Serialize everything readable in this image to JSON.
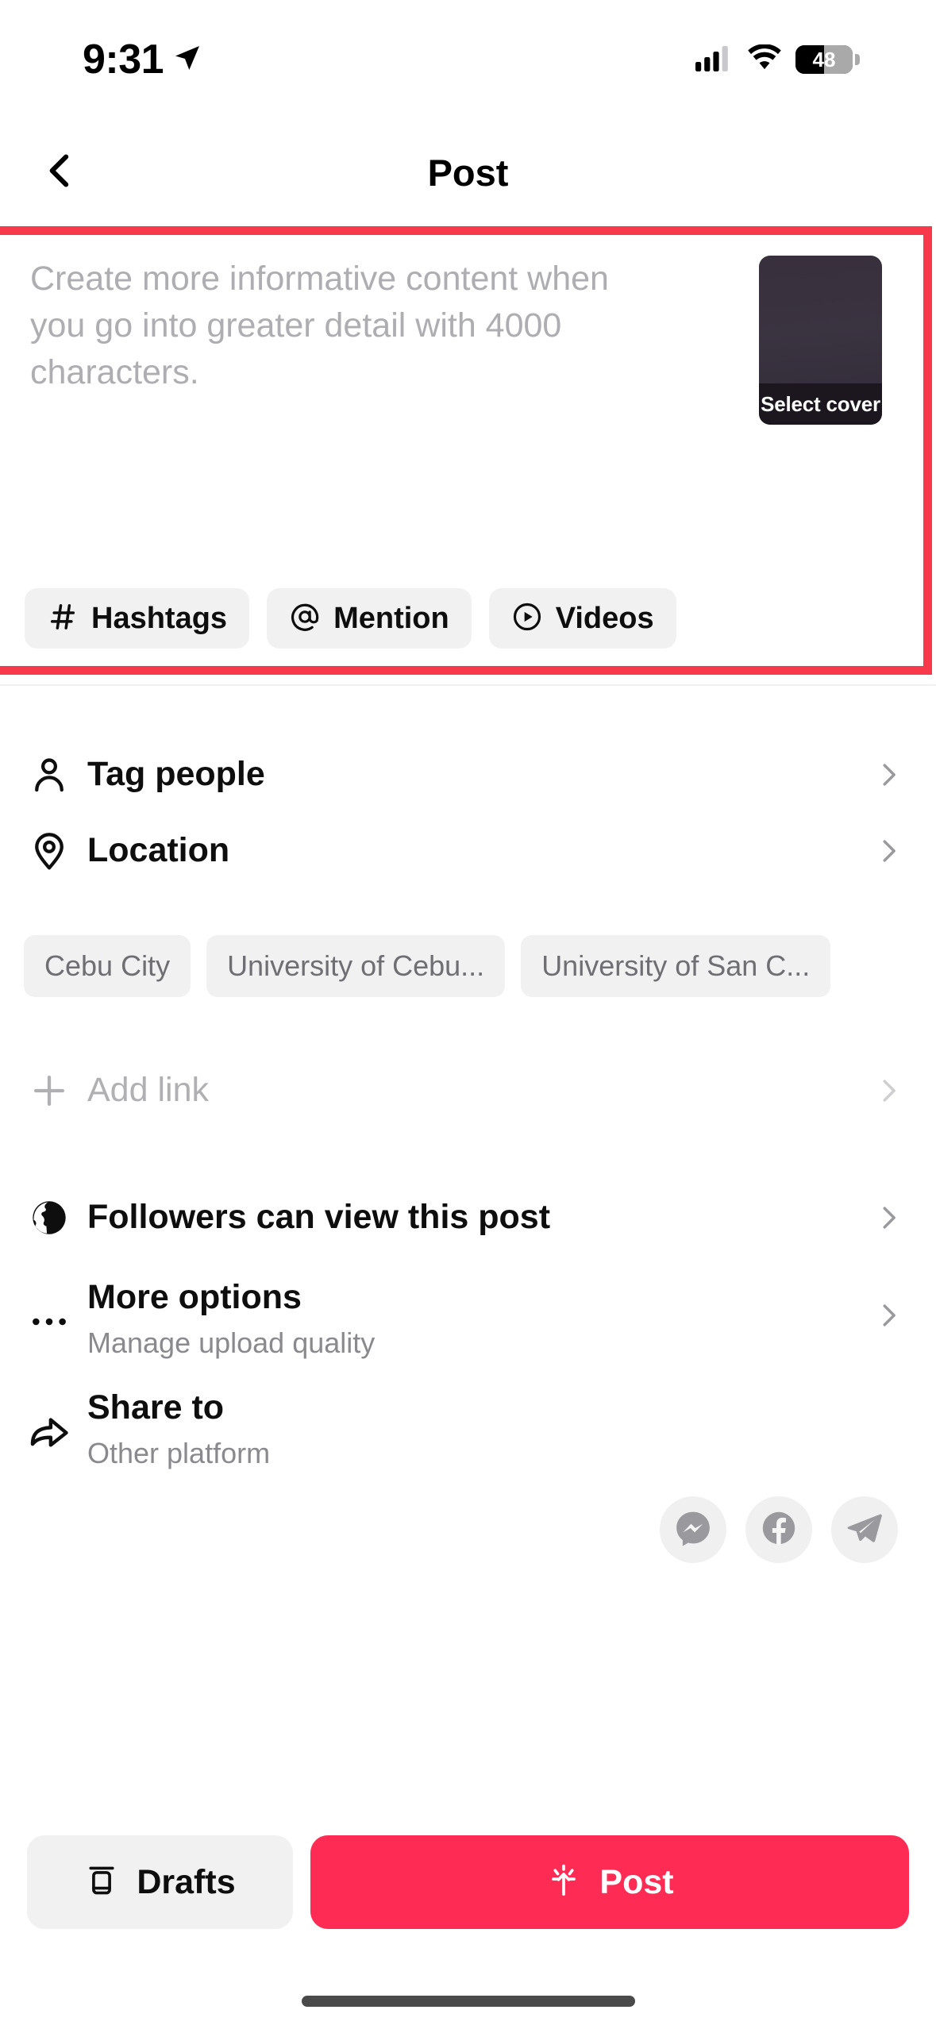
{
  "status_bar": {
    "time": "9:31",
    "location_icon": "location-arrow-icon",
    "cellular_icon": "cellular-signal-icon",
    "wifi_icon": "wifi-icon",
    "battery_level": "48",
    "battery_percent": 48
  },
  "header": {
    "back_icon": "chevron-left-icon",
    "title": "Post"
  },
  "caption": {
    "placeholder": "Create more informative content when you go into greater detail with 4000 characters.",
    "value": "",
    "cover": {
      "label": "Select cover",
      "icon": "video-cover-thumbnail"
    },
    "chips": [
      {
        "label": "Hashtags",
        "icon": "hashtag-icon"
      },
      {
        "label": "Mention",
        "icon": "at-sign-icon"
      },
      {
        "label": "Videos",
        "icon": "play-circle-icon"
      }
    ]
  },
  "highlight": {
    "color": "#F8394B"
  },
  "rows": {
    "tag_people": {
      "title": "Tag people",
      "icon": "person-icon",
      "chevron": "chevron-right-icon"
    },
    "location": {
      "title": "Location",
      "icon": "map-pin-icon",
      "chevron": "chevron-right-icon"
    },
    "add_link": {
      "title": "Add link",
      "icon": "plus-icon",
      "chevron": "chevron-right-icon"
    },
    "privacy": {
      "title": "Followers can view this post",
      "icon": "globe-icon",
      "chevron": "chevron-right-icon"
    },
    "more_options": {
      "title": "More options",
      "subtitle": "Manage upload quality",
      "icon": "ellipsis-icon",
      "chevron": "chevron-right-icon"
    },
    "share_to": {
      "title": "Share to",
      "subtitle": "Other platform",
      "icon": "share-arrow-icon"
    }
  },
  "location_suggestions": [
    "Cebu City",
    "University of Cebu...",
    "University of San C..."
  ],
  "share_targets": [
    {
      "name": "messenger-icon"
    },
    {
      "name": "facebook-icon"
    },
    {
      "name": "telegram-icon"
    }
  ],
  "bottom_bar": {
    "drafts": {
      "label": "Drafts",
      "icon": "drafts-box-icon"
    },
    "post": {
      "label": "Post",
      "icon": "post-upload-icon",
      "color": "#FE2C55"
    }
  }
}
